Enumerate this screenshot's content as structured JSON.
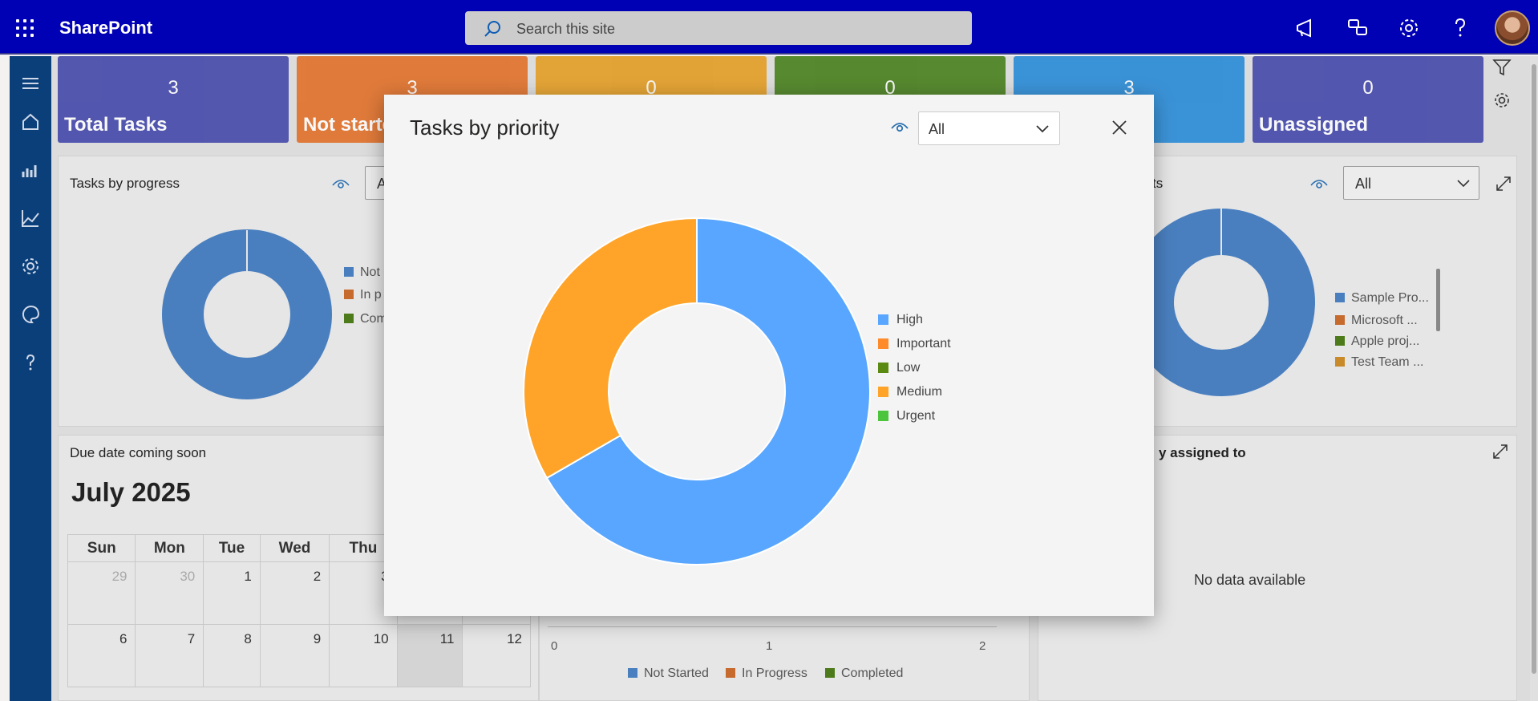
{
  "suitebar": {
    "brand": "SharePoint",
    "search_placeholder": "Search this site",
    "icons": [
      "waffle-icon",
      "megaphone-icon",
      "chat-icon",
      "gear-icon",
      "help-icon",
      "avatar"
    ]
  },
  "rail": {
    "icons": [
      "menu-icon",
      "home-icon",
      "reports-icon",
      "analytics-icon",
      "settings-icon",
      "palette-icon",
      "help-icon"
    ]
  },
  "tiles": [
    {
      "value": "3",
      "label": "Total Tasks",
      "color": "#3b3fa6"
    },
    {
      "value": "3",
      "label": "Not started",
      "color": "#e06a1e"
    },
    {
      "value": "0",
      "label": "",
      "color": "#e49a1a"
    },
    {
      "value": "0",
      "label": "",
      "color": "#3f7a12"
    },
    {
      "value": "3",
      "label": "",
      "color": "#1e86d6"
    },
    {
      "value": "0",
      "label": "Unassigned",
      "color": "#3b3fa6"
    }
  ],
  "cards": {
    "progress": {
      "title": "Tasks by progress",
      "dropdown": "A",
      "legend": [
        "Not",
        "In p",
        "Com"
      ]
    },
    "projects": {
      "title": "ts",
      "dropdown": "All",
      "legend": [
        "Sample Pro...",
        "Microsoft ...",
        "Apple proj...",
        "Test Team ..."
      ]
    },
    "due": {
      "title": "Due date coming soon",
      "month": "July 2025",
      "weekdays": [
        "Sun",
        "Mon",
        "Tue",
        "Wed",
        "Thu",
        "",
        ""
      ],
      "rows": [
        [
          "29",
          "30",
          "1",
          "2",
          "3",
          "",
          ""
        ],
        [
          "6",
          "7",
          "8",
          "9",
          "10",
          "11",
          "12"
        ]
      ]
    },
    "bar": {
      "ticks": [
        "0",
        "1",
        "2"
      ],
      "legend": [
        "Not Started",
        "In Progress",
        "Completed"
      ]
    },
    "assigned": {
      "title": "y assigned to",
      "empty": "No data available"
    }
  },
  "modal": {
    "title": "Tasks by priority",
    "dropdown_value": "All"
  },
  "chart_data": {
    "type": "pie",
    "title": "Tasks by priority",
    "donut": true,
    "categories": [
      "High",
      "Important",
      "Low",
      "Medium",
      "Urgent"
    ],
    "values": [
      2,
      0,
      0,
      1,
      0
    ],
    "colors": [
      "#58a6ff",
      "#ff8a2a",
      "#5b8a12",
      "#ffa429",
      "#4cc43c"
    ],
    "legend_position": "right"
  }
}
